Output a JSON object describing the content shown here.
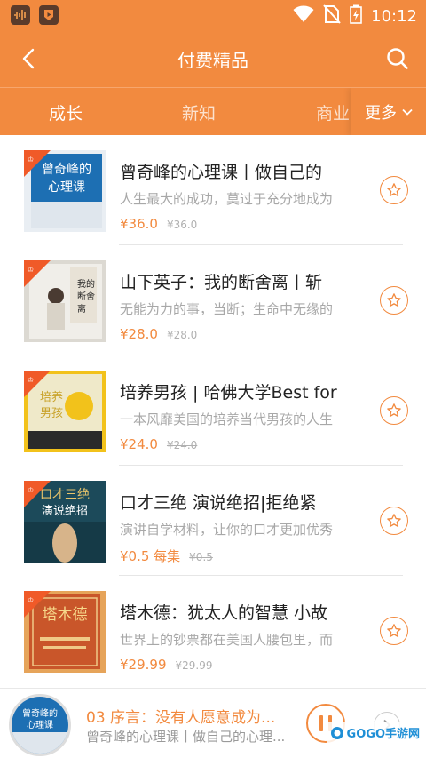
{
  "status_bar": {
    "time": "10:12",
    "icons": [
      "audio-app-icon",
      "play-app-icon",
      "wifi-icon",
      "no-sim-icon",
      "battery-charging-icon"
    ]
  },
  "header": {
    "title": "付费精品"
  },
  "tabs": {
    "items": [
      "成长",
      "新知",
      "商业"
    ],
    "active": "成长",
    "more_label": "更多"
  },
  "books": [
    {
      "title": "曾奇峰的心理课丨做自己的",
      "desc": "人生最大的成功，莫过于充分地成为",
      "price": "¥36.0",
      "original": "¥36.0",
      "original_struck": false,
      "cover_text": "曾奇峰的心理课",
      "cover_colors": [
        "#1d6fb3",
        "#e9eef3"
      ]
    },
    {
      "title": "山下英子：我的断舍离丨斩",
      "desc": "无能为力的事，当断；生命中无缘的",
      "price": "¥28.0",
      "original": "¥28.0",
      "original_struck": false,
      "cover_text": "我的断舍离",
      "cover_colors": [
        "#f0eee9",
        "#c9c4bb"
      ]
    },
    {
      "title": "培养男孩 | 哈佛大学Best for",
      "desc": "一本风靡美国的培养当代男孩的人生",
      "price": "¥24.0",
      "original": "¥24.0",
      "original_struck": true,
      "cover_text": "培养男孩",
      "cover_colors": [
        "#f2c21b",
        "#efe9c9"
      ]
    },
    {
      "title": "口才三绝 演说绝招|拒绝紧",
      "desc": "演讲自学材料，让你的口才更加优秀",
      "price": "¥0.5 每集",
      "original": "¥0.5",
      "original_struck": true,
      "cover_text": "口才三绝 演说绝招",
      "cover_colors": [
        "#1c4a5a",
        "#c9a24b"
      ]
    },
    {
      "title": "塔木德：犹太人的智慧 小故",
      "desc": "世界上的钞票都在美国人腰包里，而",
      "price": "¥29.99",
      "original": "¥29.99",
      "original_struck": true,
      "cover_text": "塔木德",
      "cover_colors": [
        "#c9562a",
        "#e6a45a"
      ]
    }
  ],
  "player": {
    "track": "03 序言：没有人愿意成为...",
    "book": "曾奇峰的心理课丨做自己的心理..."
  },
  "watermark": {
    "text": "GOGO手游网"
  },
  "colors": {
    "accent": "#f28a3f",
    "text_primary": "#222222",
    "text_secondary": "#a8a8a8"
  }
}
